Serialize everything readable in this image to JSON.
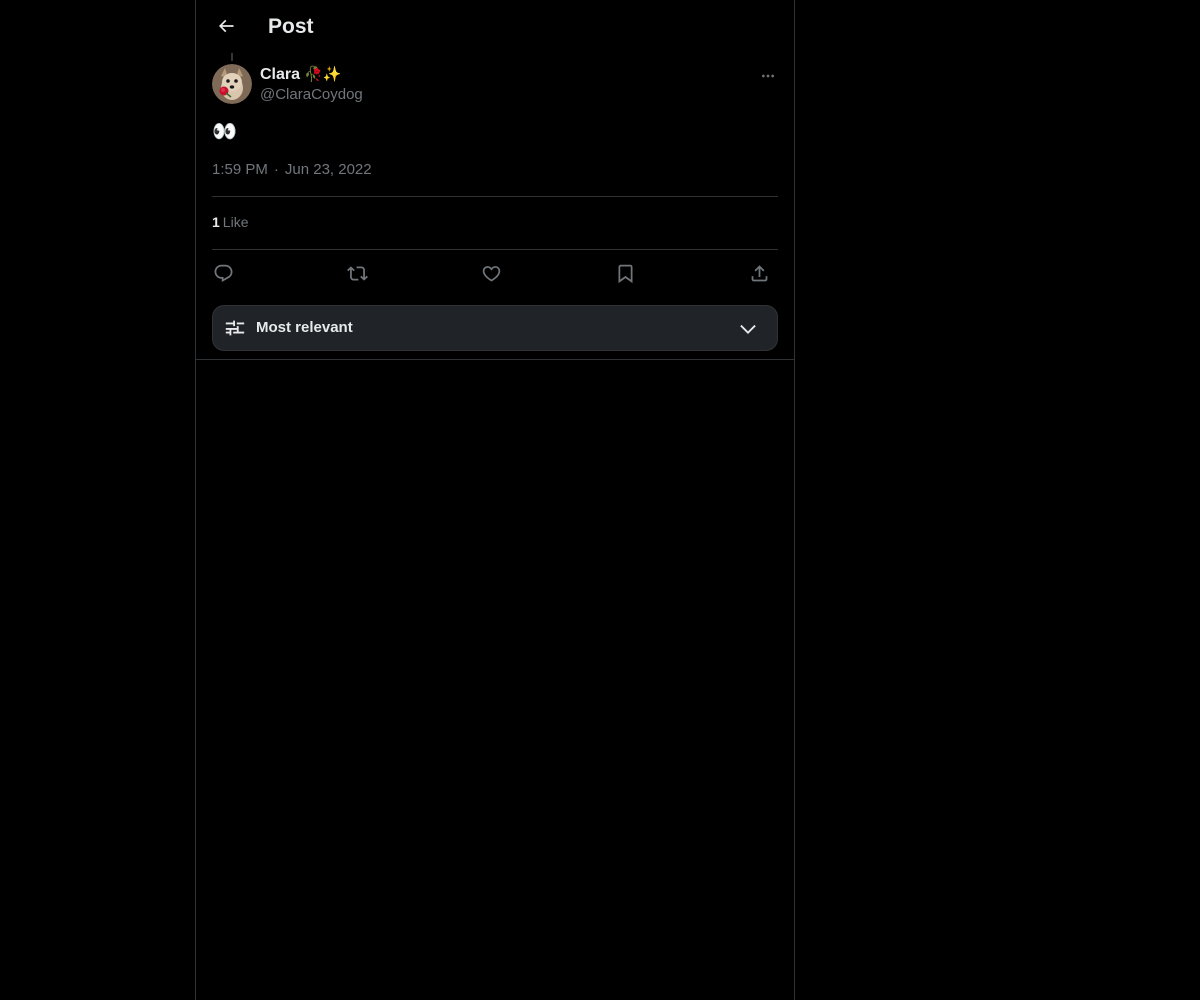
{
  "header": {
    "title": "Post",
    "back_icon": "arrow-left-icon"
  },
  "post": {
    "author": {
      "display_name": "Clara",
      "name_emojis": "🥀✨",
      "handle": "@ClaraCoydog",
      "avatar_icon": "avatar-dog-with-rose"
    },
    "text": "👀",
    "time": "1:59 PM",
    "separator": "·",
    "date": "Jun 23, 2022",
    "likes": {
      "count": "1",
      "label": "Like"
    },
    "actions": {
      "reply_icon": "reply-icon",
      "repost_icon": "repost-icon",
      "like_icon": "heart-icon",
      "bookmark_icon": "bookmark-icon",
      "share_icon": "share-icon"
    }
  },
  "sort": {
    "label": "Most relevant"
  },
  "colors": {
    "background": "#000000",
    "border": "#2f3336",
    "text_primary": "#e7e9ea",
    "text_secondary": "#71767b",
    "sort_bar_bg": "#202327"
  }
}
